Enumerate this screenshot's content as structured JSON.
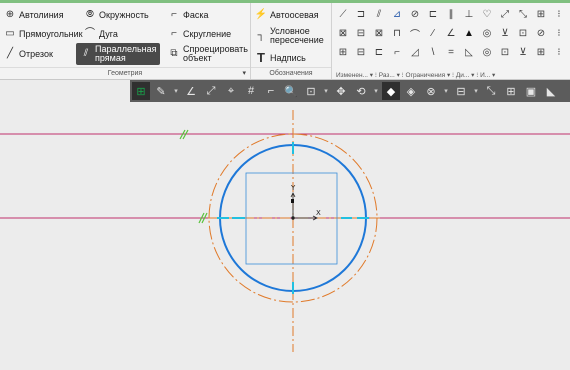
{
  "ribbon": {
    "geometry": {
      "tools": [
        {
          "name": "autoline",
          "label": "Автолиния",
          "icon": "autoline-icon"
        },
        {
          "name": "circle",
          "label": "Окружность",
          "icon": "circle-icon"
        },
        {
          "name": "chamfer",
          "label": "Фаска",
          "icon": "chamfer-icon"
        },
        {
          "name": "rectangle",
          "label": "Прямоугольник",
          "icon": "rectangle-icon"
        },
        {
          "name": "arc",
          "label": "Дуга",
          "icon": "arc-icon"
        },
        {
          "name": "fillet",
          "label": "Скругление",
          "icon": "fillet-icon"
        },
        {
          "name": "segment",
          "label": "Отрезок",
          "icon": "segment-icon"
        },
        {
          "name": "parallel-line",
          "label_line1": "Параллельная",
          "label_line2": "прямая",
          "icon": "parallel-line-icon"
        },
        {
          "name": "project-object",
          "label_line1": "Спроецировать",
          "label_line2": "объект",
          "icon": "project-icon"
        }
      ],
      "footer": "Геометрия"
    },
    "annotations": {
      "tools": [
        {
          "name": "centerline",
          "label": "Автоосевая",
          "icon": "centerline-icon"
        },
        {
          "name": "conditional-intersection",
          "label_line1": "Условное",
          "label_line2": "пересечение",
          "icon": "intersection-icon"
        },
        {
          "name": "text",
          "label": "Надпись",
          "icon": "text-icon"
        }
      ],
      "footer": "Обозначения"
    },
    "small_footers": [
      "Изменен...",
      "Раз...",
      "Ограничения",
      "Ди...",
      "И..."
    ]
  },
  "toolbar2": {
    "items": [
      "grid-snap-icon",
      "pen-icon",
      "angle-icon",
      "snap-icon",
      "origin-icon",
      "grid-icon",
      "ortho-icon",
      "zoom-icon",
      "zoom-box-icon",
      "pan-icon",
      "rotate-icon",
      "shaded-icon",
      "wireframe-icon",
      "hide-icon",
      "section-icon",
      "scale-icon",
      "display-icon",
      "view-icon"
    ]
  },
  "canvas": {
    "axis_y_label": "Y",
    "axis_x_label": "X",
    "colors": {
      "magenta_line": "#c0306b",
      "orange_centerline": "#e07a2a",
      "blue_circle": "#1e78d8",
      "aux_square": "#3a8cd8",
      "cyan_marks": "#21c0e0",
      "green_hatch": "#57c23a",
      "background": "#ececec"
    }
  }
}
